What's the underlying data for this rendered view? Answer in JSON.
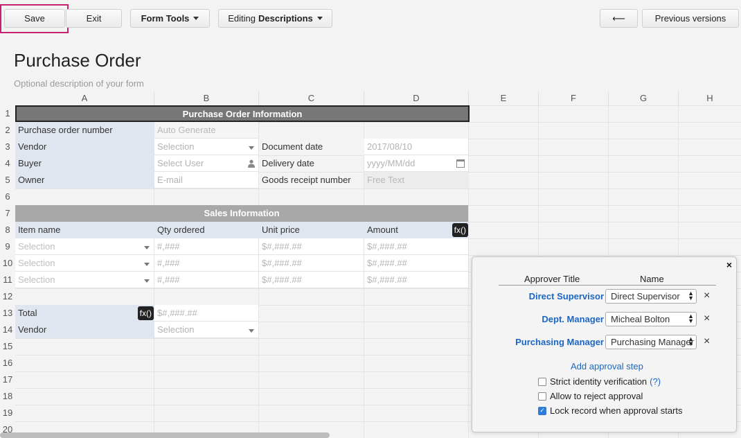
{
  "toolbar": {
    "save": "Save",
    "exit": "Exit",
    "form_tools": "Form Tools",
    "editing_prefix": "Editing",
    "editing_value": "Descriptions",
    "back_arrow": "⟵",
    "previous_versions": "Previous versions"
  },
  "form": {
    "title": "Purchase Order",
    "description_placeholder": "Optional description of your form"
  },
  "columns": [
    "A",
    "B",
    "C",
    "D",
    "E",
    "F",
    "G",
    "H"
  ],
  "rows": [
    "1",
    "2",
    "3",
    "4",
    "5",
    "6",
    "7",
    "8",
    "9",
    "10",
    "11",
    "12",
    "13",
    "14",
    "15",
    "16",
    "17",
    "18",
    "19",
    "20"
  ],
  "sections": {
    "po_info": "Purchase Order Information",
    "sales_info": "Sales Information"
  },
  "cells": {
    "po_number_label": "Purchase order number",
    "po_number_value": "Auto Generate",
    "vendor_label": "Vendor",
    "vendor_value": "Selection",
    "document_date_label": "Document date",
    "document_date_value": "2017/08/10",
    "buyer_label": "Buyer",
    "buyer_value": "Select User",
    "delivery_date_label": "Delivery date",
    "delivery_date_value": "yyyy/MM/dd",
    "owner_label": "Owner",
    "owner_value": "E-mail",
    "goods_receipt_label": "Goods receipt number",
    "goods_receipt_value": "Free Text",
    "item_name_header": "Item name",
    "qty_header": "Qty ordered",
    "unit_price_header": "Unit price",
    "amount_header": "Amount",
    "fx": "fx()",
    "item_rows": [
      {
        "item": "Selection",
        "qty": "#,###",
        "price": "$#,###.##",
        "amount": "$#,###.##"
      },
      {
        "item": "Selection",
        "qty": "#,###",
        "price": "$#,###.##",
        "amount": "$#,###.##"
      },
      {
        "item": "Selection",
        "qty": "#,###",
        "price": "$#,###.##",
        "amount": "$#,###.##"
      }
    ],
    "total_label": "Total",
    "total_value": "$#,###.##",
    "vendor2_label": "Vendor",
    "vendor2_value": "Selection"
  },
  "approval": {
    "close": "×",
    "header_title": "Approver Title",
    "header_name": "Name",
    "steps": [
      {
        "title": "Direct Supervisor",
        "name": "Direct Supervisor"
      },
      {
        "title": "Dept. Manager",
        "name": "Micheal Bolton"
      },
      {
        "title": "Purchasing Manager",
        "name": "Purchasing Manager"
      }
    ],
    "remove": "×",
    "add_step": "Add approval step",
    "options": [
      {
        "label": "Strict identity verification",
        "checked": false,
        "help": "(?)"
      },
      {
        "label": "Allow to reject approval",
        "checked": false
      },
      {
        "label": "Lock record when approval starts",
        "checked": true
      }
    ]
  },
  "colors": {
    "accent_link": "#1a66c2",
    "save_highlight": "#c7206f",
    "label_bg": "#dfe6ef",
    "section_dark": "#777777",
    "section_mid": "#a8a8a8"
  }
}
